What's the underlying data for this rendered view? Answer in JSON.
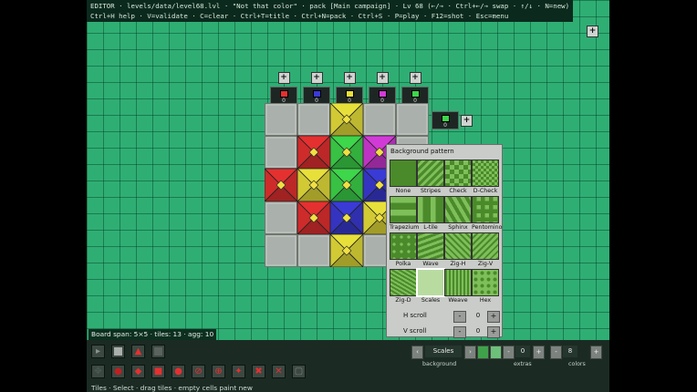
{
  "header": {
    "line1": "EDITOR · levels/data/level68.lvl · \"Not that color\" · pack [Main campaign] · Lv 68 (←/→ · Ctrl+←/→ swap · ↑/↓ · N=new)",
    "line2": "Ctrl+H help · V=validate · C=clear · Ctrl+T=title · Ctrl+N=pack · Ctrl+S · P=play · F12=shot · Esc=menu"
  },
  "colors": {
    "red": "#e53030",
    "blue": "#3a3ad6",
    "yellow": "#e8e03a",
    "magenta": "#d23ad8",
    "green": "#3ed64a",
    "empty_tile": "#aab0ab",
    "field_green": "#2fae74",
    "pattern_dark": "#4a8a2a",
    "pattern_light": "#7fbf5a"
  },
  "columns": [
    {
      "color_key": "red",
      "count": "0"
    },
    {
      "color_key": "blue",
      "count": "0"
    },
    {
      "color_key": "yellow",
      "count": "0"
    },
    {
      "color_key": "magenta",
      "count": "0"
    },
    {
      "color_key": "green",
      "count": "0"
    }
  ],
  "side_swatch": {
    "color_key": "green",
    "count": "0"
  },
  "board": {
    "rows": [
      [
        null,
        null,
        "yellow",
        null,
        null
      ],
      [
        null,
        "red",
        "green",
        "magenta",
        null
      ],
      [
        "red",
        "yellow",
        "green",
        "blue",
        null
      ],
      [
        null,
        "red",
        "blue",
        "yellow",
        null
      ],
      [
        null,
        null,
        "yellow",
        null,
        null
      ]
    ]
  },
  "panel": {
    "title": "Background pattern",
    "patterns": [
      {
        "name": "None",
        "icon": "pattern-none-icon"
      },
      {
        "name": "Stripes",
        "icon": "pattern-stripes-icon"
      },
      {
        "name": "Check",
        "icon": "pattern-check-icon"
      },
      {
        "name": "D-Check",
        "icon": "pattern-dcheck-icon"
      },
      {
        "name": "Trapezium",
        "icon": "pattern-trapezium-icon"
      },
      {
        "name": "L-tile",
        "icon": "pattern-ltile-icon"
      },
      {
        "name": "Sphinx",
        "icon": "pattern-sphinx-icon"
      },
      {
        "name": "Pentomino",
        "icon": "pattern-pentomino-icon"
      },
      {
        "name": "Polka",
        "icon": "pattern-polka-icon"
      },
      {
        "name": "Wave",
        "icon": "pattern-wave-icon"
      },
      {
        "name": "Zig-H",
        "icon": "pattern-zigh-icon"
      },
      {
        "name": "Zig-V",
        "icon": "pattern-zigv-icon"
      },
      {
        "name": "Zig-D",
        "icon": "pattern-zigd-icon"
      },
      {
        "name": "Scales",
        "icon": "pattern-scales-icon",
        "selected": true
      },
      {
        "name": "Weave",
        "icon": "pattern-weave-icon"
      },
      {
        "name": "Hex",
        "icon": "pattern-hex-icon"
      }
    ],
    "h_scroll": {
      "label": "H scroll",
      "value": "0",
      "minus": "-",
      "plus": "+"
    },
    "v_scroll": {
      "label": "V scroll",
      "value": "0",
      "minus": "-",
      "plus": "+"
    }
  },
  "status": "Board span: 5×5 · tiles: 13 · agg: 10",
  "toolbar": {
    "hint": "Tiles · Select · drag tiles · empty cells paint new",
    "background": {
      "label": "background",
      "value": "Scales",
      "prev": "‹",
      "next": "›"
    },
    "extras": {
      "label": "extras",
      "value": "0",
      "minus": "-",
      "plus": "+"
    },
    "colors": {
      "label": "colors",
      "value": "8",
      "minus": "-",
      "plus": "+"
    },
    "tools_row1": [
      "select-icon",
      "tile-icon",
      "red-triangle-icon",
      "dark-tile-icon"
    ],
    "tools_row2": [
      "move-icon",
      "bomb-icon",
      "red-diamond-icon",
      "red-square-icon",
      "red-circle-icon",
      "red-ban-icon",
      "red-cross-circle-icon",
      "red-star-icon",
      "red-x-icon",
      "red-x-thin-icon",
      "frame-icon"
    ]
  }
}
